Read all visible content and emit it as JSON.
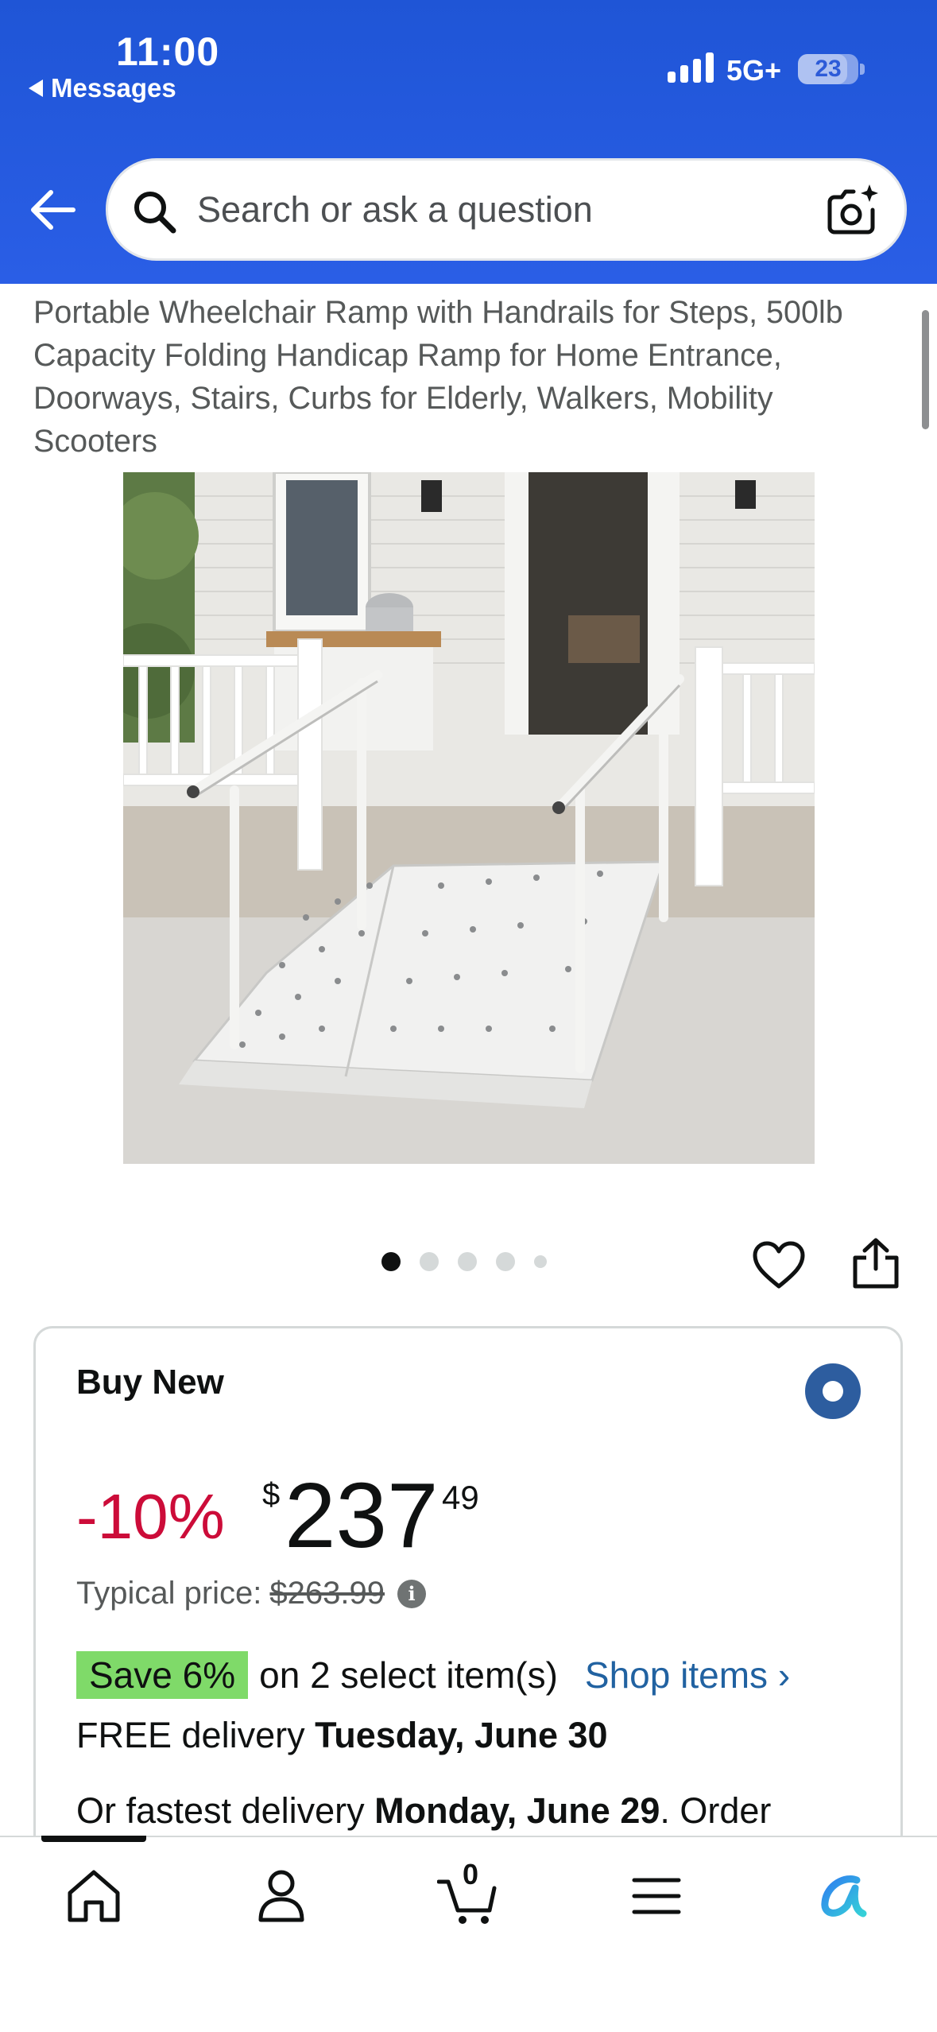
{
  "status_bar": {
    "time": "11:00",
    "back_app": "Messages",
    "network": "5G+",
    "battery": "23"
  },
  "search": {
    "placeholder": "Search or ask a question"
  },
  "product": {
    "title": "Portable Wheelchair Ramp with Handrails for Steps, 500lb Capacity Folding Handicap Ramp for Home Entrance, Doorways, Stairs, Curbs for Elderly, Walkers, Mobility Scooters",
    "image_count": 5,
    "active_image": 1
  },
  "buy_box": {
    "label": "Buy New",
    "discount": "-10%",
    "currency": "$",
    "price_whole": "237",
    "price_fraction": "49",
    "typical_label": "Typical price:",
    "typical_price": "$263.99",
    "save_badge": "Save 6%",
    "save_text": "on 2 select item(s)",
    "shop_link": "Shop items ›",
    "delivery_prefix": "FREE delivery ",
    "delivery_date": "Tuesday, June 30",
    "fastest_prefix": "Or fastest delivery ",
    "fastest_date": "Monday, June 29",
    "fastest_suffix": ". Order"
  },
  "bottom_nav": {
    "cart_count": "0",
    "items": [
      "home-icon",
      "account-icon",
      "cart-icon",
      "menu-icon",
      "rufus-icon"
    ]
  },
  "colors": {
    "header_blue": "#2a5ee6",
    "discount_red": "#cc0c39",
    "link_blue": "#2162a1",
    "save_green": "#7fda69",
    "radio_blue": "#2d5d9f"
  }
}
